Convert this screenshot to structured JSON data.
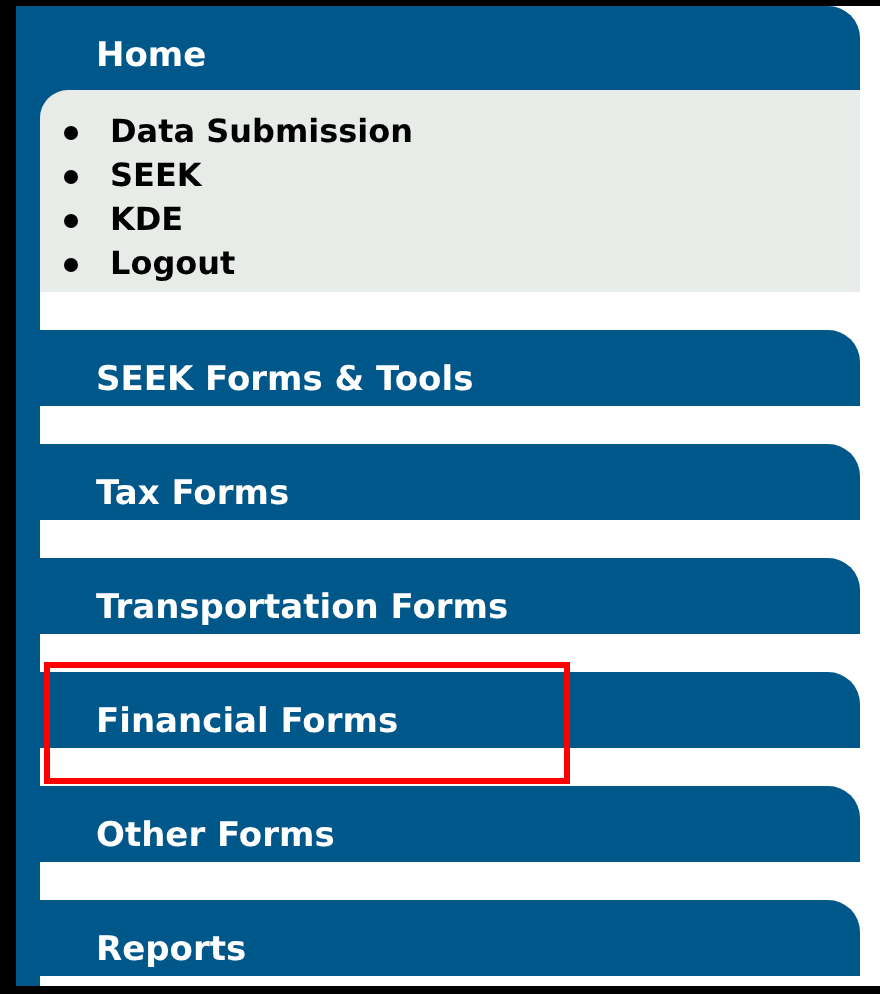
{
  "sections": [
    {
      "title": "Home",
      "highlighted": false,
      "items": [
        "Data Submission",
        "SEEK",
        "KDE",
        "Logout"
      ]
    },
    {
      "title": "SEEK Forms & Tools",
      "highlighted": false
    },
    {
      "title": "Tax Forms",
      "highlighted": false
    },
    {
      "title": "Transportation Forms",
      "highlighted": false
    },
    {
      "title": "Financial Forms",
      "highlighted": true
    },
    {
      "title": "Other Forms",
      "highlighted": false
    },
    {
      "title": "Reports",
      "highlighted": false
    }
  ]
}
